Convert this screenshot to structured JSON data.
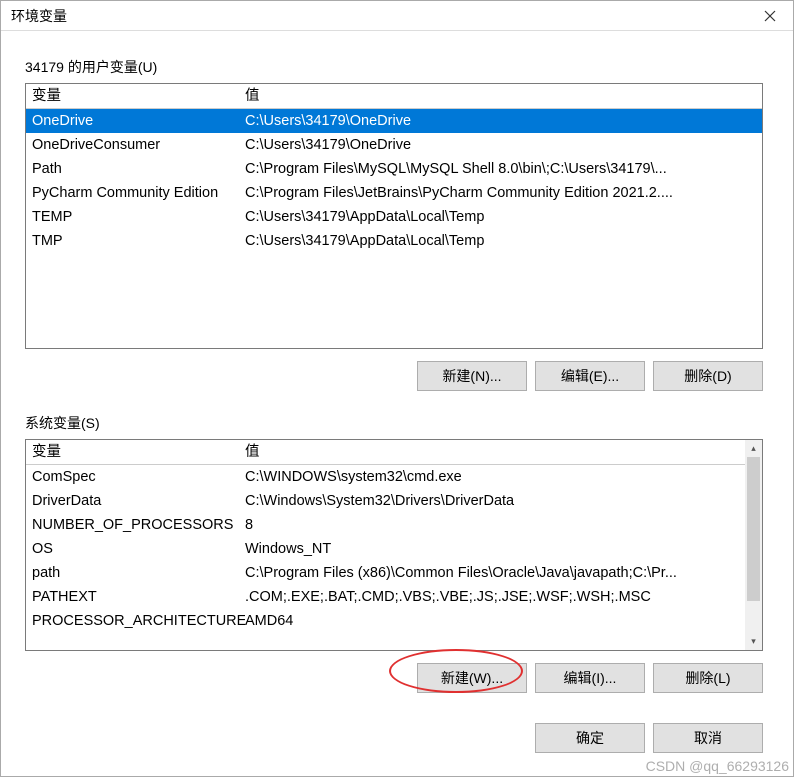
{
  "window": {
    "title": "环境变量",
    "close_icon": "close"
  },
  "user_section": {
    "label": "34179 的用户变量(U)",
    "header": {
      "var": "变量",
      "val": "值"
    },
    "rows": [
      {
        "var": "OneDrive",
        "val": "C:\\Users\\34179\\OneDrive",
        "selected": true
      },
      {
        "var": "OneDriveConsumer",
        "val": "C:\\Users\\34179\\OneDrive"
      },
      {
        "var": "Path",
        "val": "C:\\Program Files\\MySQL\\MySQL Shell 8.0\\bin\\;C:\\Users\\34179\\..."
      },
      {
        "var": "PyCharm Community Edition",
        "val": "C:\\Program Files\\JetBrains\\PyCharm Community Edition 2021.2...."
      },
      {
        "var": "TEMP",
        "val": "C:\\Users\\34179\\AppData\\Local\\Temp"
      },
      {
        "var": "TMP",
        "val": "C:\\Users\\34179\\AppData\\Local\\Temp"
      }
    ],
    "buttons": {
      "new": "新建(N)...",
      "edit": "编辑(E)...",
      "delete": "删除(D)"
    }
  },
  "system_section": {
    "label": "系统变量(S)",
    "header": {
      "var": "变量",
      "val": "值"
    },
    "rows": [
      {
        "var": "ComSpec",
        "val": "C:\\WINDOWS\\system32\\cmd.exe"
      },
      {
        "var": "DriverData",
        "val": "C:\\Windows\\System32\\Drivers\\DriverData"
      },
      {
        "var": "NUMBER_OF_PROCESSORS",
        "val": "8"
      },
      {
        "var": "OS",
        "val": "Windows_NT"
      },
      {
        "var": "path",
        "val": "C:\\Program Files (x86)\\Common Files\\Oracle\\Java\\javapath;C:\\Pr..."
      },
      {
        "var": "PATHEXT",
        "val": ".COM;.EXE;.BAT;.CMD;.VBS;.VBE;.JS;.JSE;.WSF;.WSH;.MSC"
      },
      {
        "var": "PROCESSOR_ARCHITECTURE",
        "val": "AMD64"
      }
    ],
    "buttons": {
      "new": "新建(W)...",
      "edit": "编辑(I)...",
      "delete": "删除(L)"
    }
  },
  "dialog_buttons": {
    "ok": "确定",
    "cancel": "取消"
  },
  "watermark": "CSDN @qq_66293126"
}
